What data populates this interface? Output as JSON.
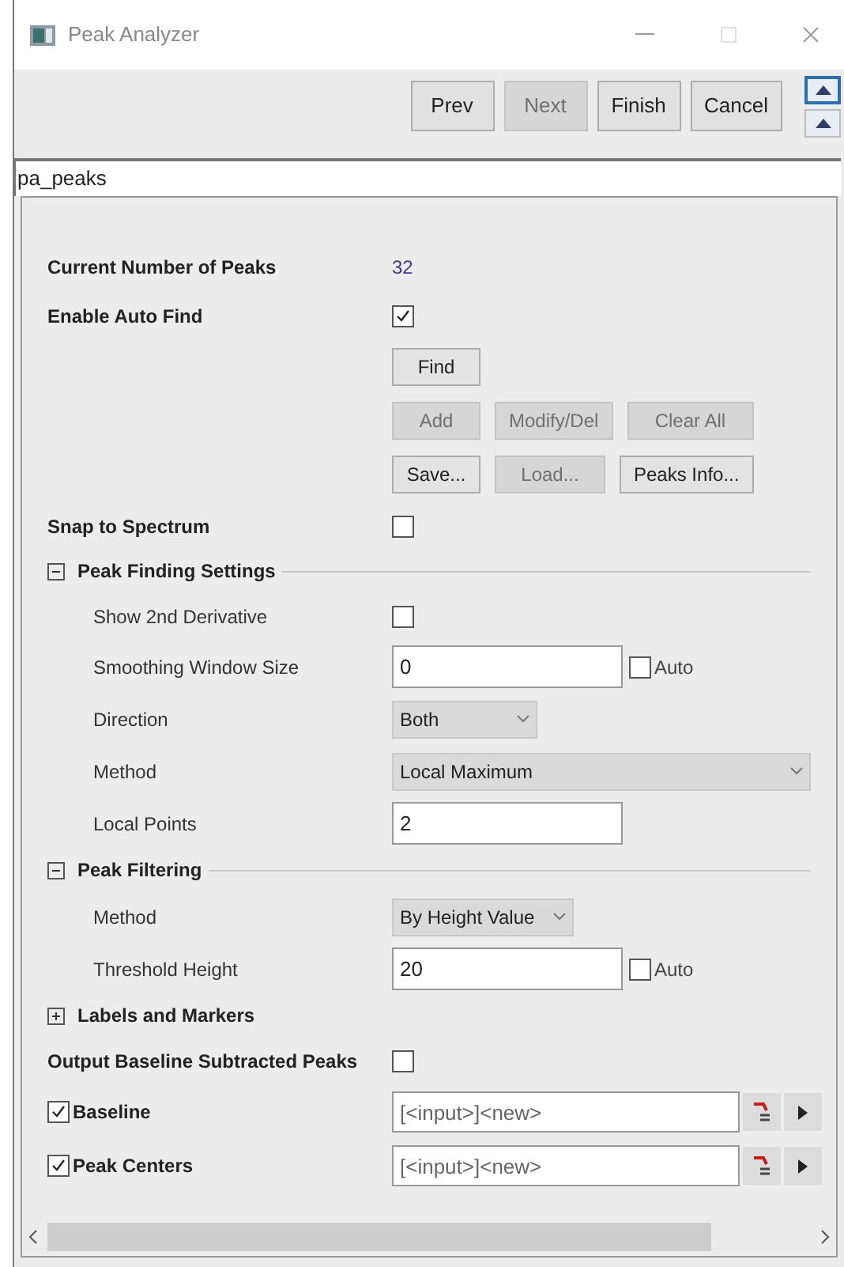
{
  "window": {
    "title": "Peak Analyzer"
  },
  "nav_buttons": [
    {
      "label": "Prev",
      "disabled": false
    },
    {
      "label": "Next",
      "disabled": true
    },
    {
      "label": "Finish",
      "disabled": false
    },
    {
      "label": "Cancel",
      "disabled": false
    }
  ],
  "theme_name": "pa_peaks",
  "rows": [
    {
      "kind": "value",
      "label": "Current Number of Peaks",
      "value": "32"
    },
    {
      "kind": "checkbox",
      "label": "Enable Auto Find",
      "checked": true
    },
    {
      "kind": "buttons",
      "buttons": [
        {
          "label": "Find",
          "disabled": false
        }
      ]
    },
    {
      "kind": "buttons",
      "buttons": [
        {
          "label": "Add",
          "disabled": true
        },
        {
          "label": "Modify/Del",
          "disabled": true
        },
        {
          "label": "Clear All",
          "disabled": true
        }
      ]
    },
    {
      "kind": "buttons",
      "buttons": [
        {
          "label": "Save...",
          "disabled": false
        },
        {
          "label": "Load...",
          "disabled": true
        },
        {
          "label": "Peaks Info...",
          "disabled": false
        }
      ]
    },
    {
      "kind": "checkbox",
      "label": "Snap to Spectrum",
      "checked": false
    },
    {
      "kind": "group",
      "label": "Peak Finding Settings",
      "expanded": true,
      "children": [
        {
          "kind": "checkbox",
          "label": "Show 2nd Derivative",
          "checked": false
        },
        {
          "kind": "text",
          "label": "Smoothing Window Size",
          "value": "0",
          "auto": {
            "label": "Auto",
            "checked": false
          }
        },
        {
          "kind": "select",
          "label": "Direction",
          "value": "Both"
        },
        {
          "kind": "wide_select",
          "label": "Method",
          "value": "Local Maximum"
        },
        {
          "kind": "text",
          "label": "Local Points",
          "value": "2"
        }
      ]
    },
    {
      "kind": "group",
      "label": "Peak Filtering",
      "expanded": true,
      "children": [
        {
          "kind": "select",
          "label": "Method",
          "value": "By Height Value"
        },
        {
          "kind": "text",
          "label": "Threshold Height",
          "value": "20",
          "auto": {
            "label": "Auto",
            "checked": false
          }
        }
      ]
    },
    {
      "kind": "group",
      "label": "Labels and Markers",
      "expanded": false,
      "children": []
    },
    {
      "kind": "checkbox",
      "label": "Output Baseline Subtracted Peaks",
      "checked": false
    },
    {
      "kind": "output",
      "label": "Baseline",
      "checked": true,
      "value": "[<input>]<new>"
    },
    {
      "kind": "output",
      "label": "Peak Centers",
      "checked": true,
      "value": "[<input>]<new>"
    }
  ]
}
